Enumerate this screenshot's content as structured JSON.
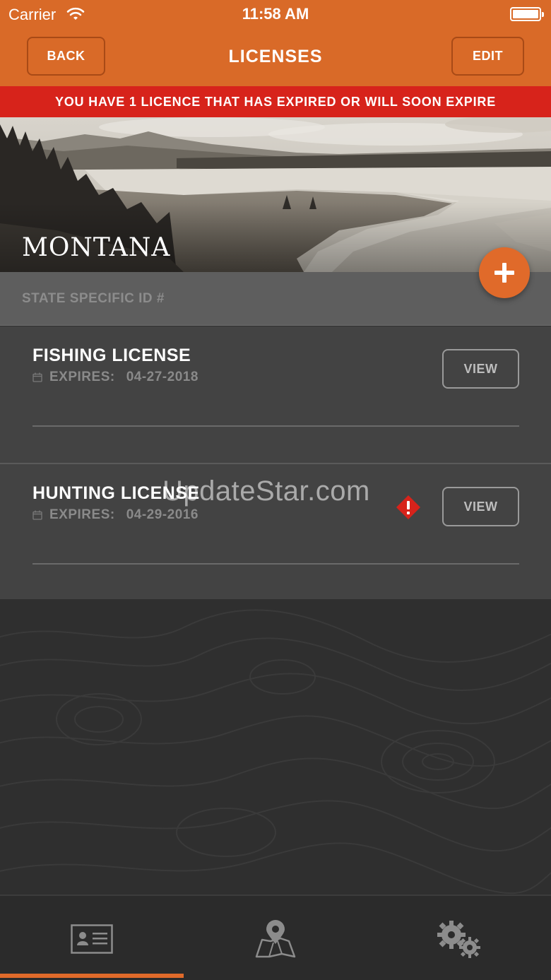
{
  "status_bar": {
    "carrier": "Carrier",
    "time": "11:58 AM"
  },
  "nav": {
    "back_label": "BACK",
    "title": "LICENSES",
    "edit_label": "EDIT"
  },
  "alert": {
    "text": "YOU HAVE 1 LICENCE THAT HAS EXPIRED OR WILL SOON EXPIRE",
    "color": "#d7231b"
  },
  "hero": {
    "state_name": "MONTANA"
  },
  "id_row": {
    "label": "STATE SPECIFIC ID #"
  },
  "add_button": {
    "icon": "plus-icon"
  },
  "licenses": [
    {
      "title": "FISHING LICENSE",
      "expires_label": "EXPIRES:",
      "expires_date": "04-27-2018",
      "view_label": "VIEW",
      "warning": false
    },
    {
      "title": "HUNTING LICENSE",
      "expires_label": "EXPIRES:",
      "expires_date": "04-29-2016",
      "view_label": "VIEW",
      "warning": true
    }
  ],
  "watermark": "UpdateStar.com",
  "tab_bar": {
    "tabs": [
      {
        "icon": "id-card-icon",
        "selected": true
      },
      {
        "icon": "map-pin-icon",
        "selected": false
      },
      {
        "icon": "gears-icon",
        "selected": false
      }
    ]
  },
  "colors": {
    "brand": "#d96a28",
    "accent": "#e06a2a",
    "alert": "#d7231b",
    "warning": "#d7231b"
  }
}
